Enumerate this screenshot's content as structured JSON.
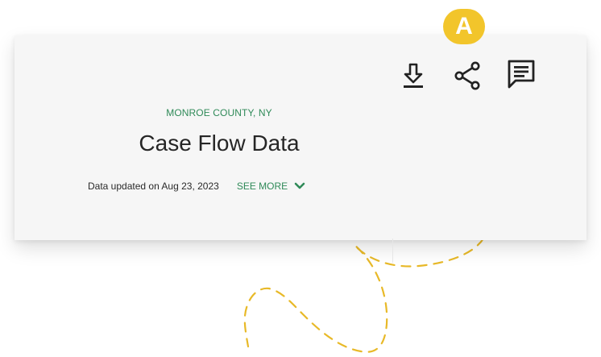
{
  "annotation": {
    "badge_label": "A"
  },
  "header": {
    "subtitle": "MONROE COUNTY, NY",
    "title": "Case Flow Data",
    "updated_text": "Data updated on Aug 23, 2023",
    "see_more_label": "SEE MORE"
  },
  "toolbar": {
    "download_icon": "download-icon",
    "share_icon": "share-icon",
    "comment_icon": "comment-icon"
  },
  "colors": {
    "accent_green": "#2f8a58",
    "badge_yellow": "#f2c52b",
    "card_background": "#f6f6f6",
    "dashed_line": "#e8b928"
  }
}
